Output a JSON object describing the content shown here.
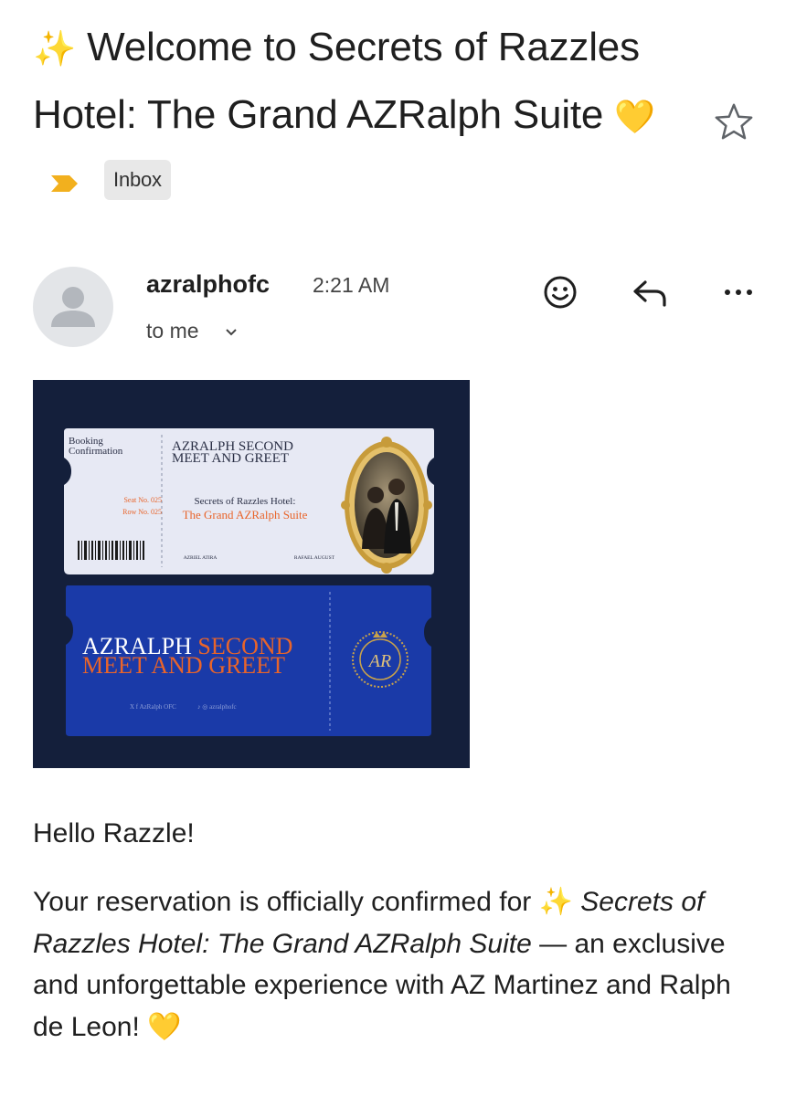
{
  "email": {
    "subject_spark": "✨",
    "subject_text": "Welcome to Secrets of Razzles Hotel: The Grand AZRalph Suite",
    "subject_heart": "💛",
    "label": "Inbox",
    "sender": "azralphofc",
    "time": "2:21 AM",
    "recipient": "to me"
  },
  "ticket": {
    "booking_label": "Booking Confirmation",
    "event_title_line1": "AZRALPH SECOND",
    "event_title_line2": "MEET AND GREET",
    "seat": "Seat No. 025",
    "row": "Row No. 025",
    "venue_line1": "Secrets of Razzles Hotel:",
    "venue_line2": "The Grand AZRalph Suite",
    "name_left": "AZRIEL ATIRA",
    "name_right": "RAFAEL AUGUST",
    "stub_line1_a": "AZRALPH ",
    "stub_line1_b": "SECOND",
    "stub_line2": "MEET AND GREET",
    "social_1": "AzRalph OFC",
    "social_2": "azralphofc",
    "monogram": "AR"
  },
  "message": {
    "greeting": "Hello Razzle!",
    "line1": "Your reservation is officially confirmed for ",
    "spark": "✨",
    "event_name": " Secrets of Razzles Hotel: The Grand AZRalph Suite",
    "line2": " — an exclusive and unforgettable experience with AZ Martinez and Ralph de Leon! ",
    "heart": "💛"
  },
  "icons": {
    "star": "star-outline",
    "label_arrow": "label-important-arrow",
    "emoji": "add-reaction",
    "reply": "reply",
    "more": "more-horizontal"
  },
  "colors": {
    "label_arrow": "#f2b01e",
    "ticket_bg": "#17233f",
    "ticket_upper": "#e7e9f4",
    "ticket_lower": "#1a3aa8",
    "orange_accent": "#e8642a"
  }
}
